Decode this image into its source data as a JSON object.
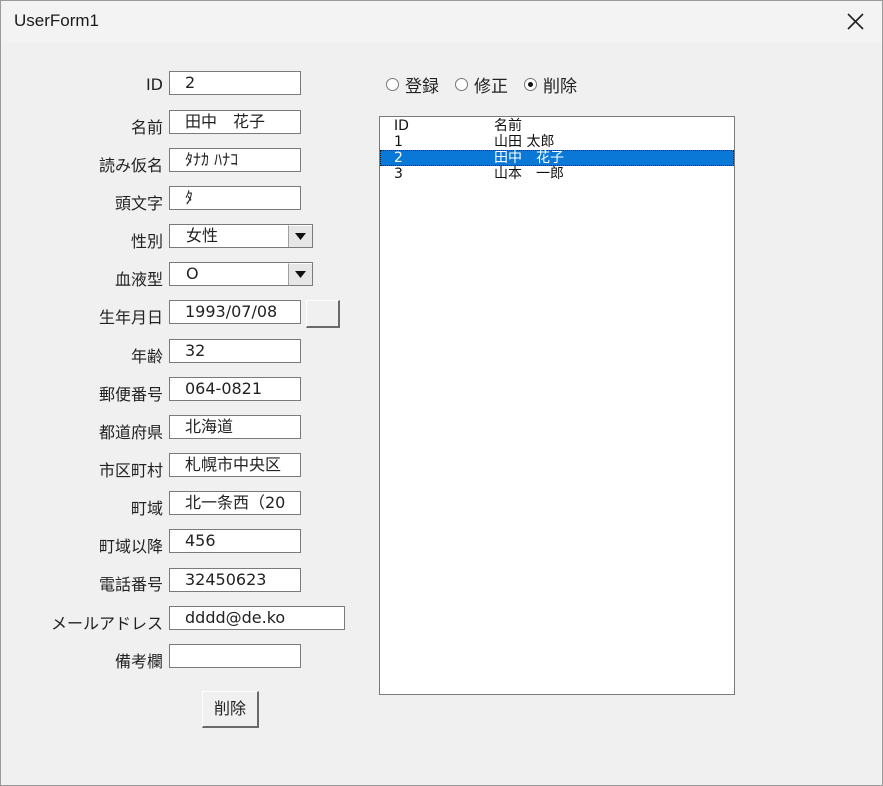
{
  "window": {
    "title": "UserForm1",
    "close_icon": "close-icon"
  },
  "fields": [
    {
      "key": "id",
      "label": "ID",
      "value": "2"
    },
    {
      "key": "name",
      "label": "名前",
      "value": "田中　花子"
    },
    {
      "key": "kana",
      "label": "読み仮名",
      "value": "ﾀﾅｶ ﾊﾅｺ"
    },
    {
      "key": "initial",
      "label": "頭文字",
      "value": "ﾀ"
    },
    {
      "key": "gender",
      "label": "性別",
      "value": "女性"
    },
    {
      "key": "blood",
      "label": "血液型",
      "value": "O"
    },
    {
      "key": "birthday",
      "label": "生年月日",
      "value": "1993/07/08"
    },
    {
      "key": "age",
      "label": "年齢",
      "value": "32"
    },
    {
      "key": "postal",
      "label": "郵便番号",
      "value": "064-0821"
    },
    {
      "key": "prefecture",
      "label": "都道府県",
      "value": "北海道"
    },
    {
      "key": "city",
      "label": "市区町村",
      "value": "札幌市中央区"
    },
    {
      "key": "town",
      "label": "町域",
      "value": "北一条西（20"
    },
    {
      "key": "town_after",
      "label": "町域以降",
      "value": "456"
    },
    {
      "key": "phone",
      "label": "電話番号",
      "value": "32450623"
    },
    {
      "key": "email",
      "label": "メールアドレス",
      "value": "dddd@de.ko"
    },
    {
      "key": "notes",
      "label": "備考欄",
      "value": ""
    }
  ],
  "mode": {
    "options": [
      "登録",
      "修正",
      "削除"
    ],
    "selected": "削除"
  },
  "list": {
    "headers": [
      "ID",
      "名前"
    ],
    "rows": [
      {
        "id": "1",
        "name": "山田 太郎"
      },
      {
        "id": "2",
        "name": "田中　花子"
      },
      {
        "id": "3",
        "name": "山本　一郎"
      }
    ],
    "selected_index": 1,
    "colors": {
      "selection": "#0a78d7"
    }
  },
  "action_button": {
    "label": "削除"
  }
}
